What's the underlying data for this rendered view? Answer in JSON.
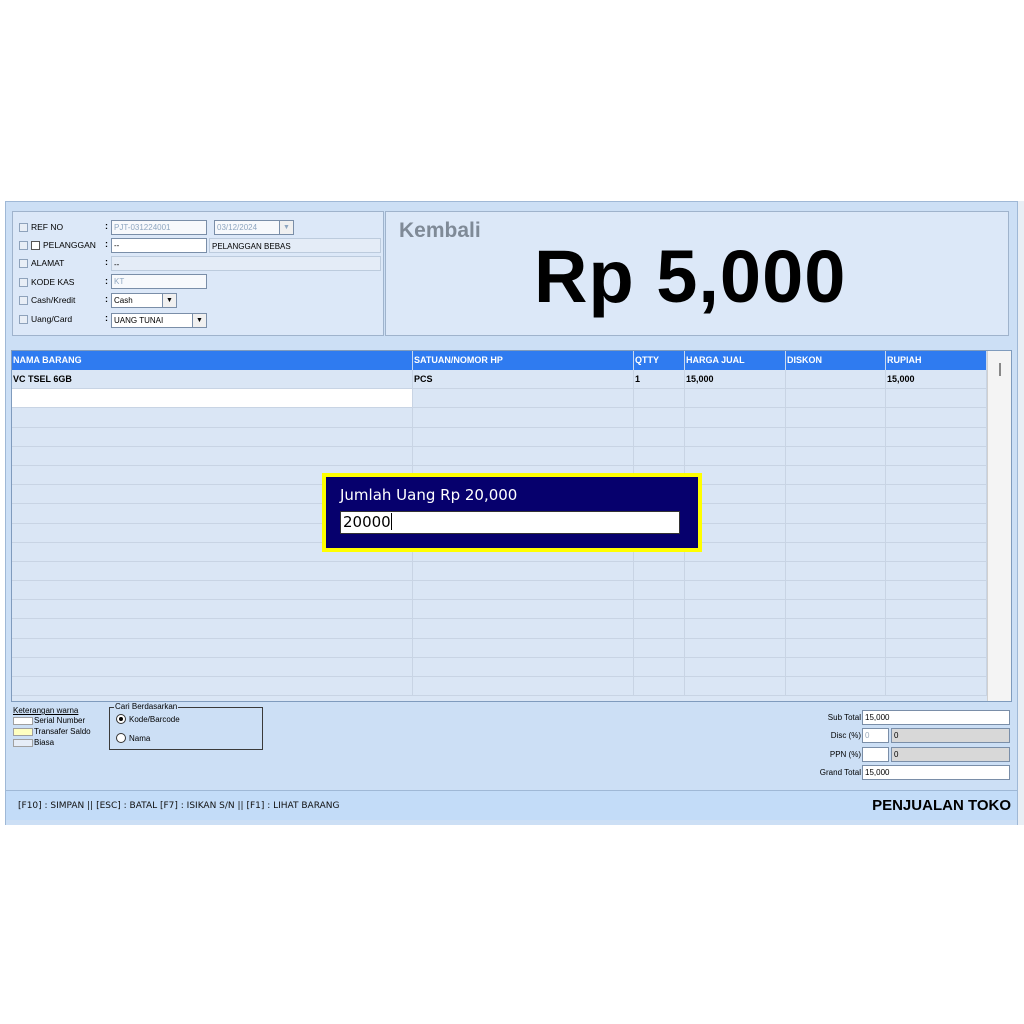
{
  "form": {
    "ref_no": {
      "label": "REF NO",
      "value": "PJT-031224001",
      "date": "03/12/2024"
    },
    "pelanggan": {
      "label": "PELANGGAN",
      "value": "--",
      "name": "PELANGGAN BEBAS"
    },
    "alamat": {
      "label": "ALAMAT",
      "value": "--"
    },
    "kode_kas": {
      "label": "KODE KAS",
      "value": "KT"
    },
    "cash_kredit": {
      "label": "Cash/Kredit",
      "value": "Cash"
    },
    "uang_card": {
      "label": "Uang/Card",
      "value": "UANG TUNAI"
    },
    "colon": ":"
  },
  "change": {
    "label": "Kembali",
    "amount": "Rp 5,000"
  },
  "grid": {
    "columns": [
      {
        "key": "nama_barang",
        "label": "NAMA BARANG"
      },
      {
        "key": "satuan",
        "label": "SATUAN/NOMOR HP"
      },
      {
        "key": "qty",
        "label": "QTTY"
      },
      {
        "key": "harga_jual",
        "label": "HARGA JUAL"
      },
      {
        "key": "diskon",
        "label": "DISKON"
      },
      {
        "key": "rupiah",
        "label": "RUPIAH"
      }
    ],
    "rows": [
      {
        "nama_barang": "VC TSEL 6GB",
        "satuan": "PCS",
        "qty": "1",
        "harga_jual": "15,000",
        "diskon": "",
        "rupiah": "15,000"
      }
    ]
  },
  "legend": {
    "title": "Keterangan warna",
    "items": [
      {
        "label": "Serial Number",
        "color": "#ffffff"
      },
      {
        "label": "Transafer Saldo",
        "color": "#ffffc0"
      },
      {
        "label": "Biasa",
        "color": "#e6edf7"
      }
    ]
  },
  "search_by": {
    "title": "Cari Berdasarkan",
    "options": [
      {
        "label": "Kode/Barcode",
        "selected": true
      },
      {
        "label": "Nama",
        "selected": false
      }
    ]
  },
  "totals": {
    "sub_total": {
      "label": "Sub Total",
      "value": "15,000"
    },
    "disc": {
      "label": "Disc (%)",
      "percent": "0",
      "value": "0"
    },
    "ppn": {
      "label": "PPN (%)",
      "percent": "",
      "value": "0"
    },
    "grand_total": {
      "label": "Grand Total",
      "value": "15,000"
    }
  },
  "status": {
    "hotkeys": "[F10] : SIMPAN  ||  [ESC] : BATAL  [F7] : ISIKAN S/N || [F1] : LIHAT BARANG",
    "module_title": "PENJUALAN TOKO"
  },
  "dialog": {
    "title": "Jumlah Uang Rp 20,000",
    "input_value": "20000"
  },
  "colors": {
    "header_blue": "#2f7bf0",
    "dialog_bg": "#06006d",
    "dialog_border": "#ffff00",
    "panel_bg": "#dce8f8"
  }
}
